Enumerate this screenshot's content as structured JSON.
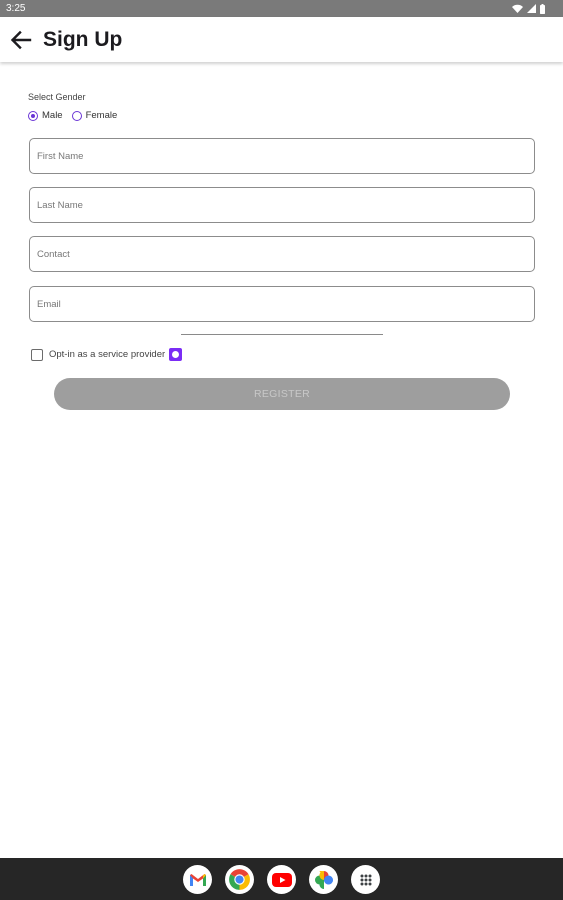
{
  "status_bar": {
    "time": "3:25",
    "icons": [
      "wifi-icon",
      "cellular-signal-icon",
      "battery-icon"
    ]
  },
  "app_bar": {
    "back_icon": "arrow-left-icon",
    "title": "Sign Up"
  },
  "form": {
    "gender_label": "Select Gender",
    "gender_options": [
      {
        "label": "Male",
        "selected": true
      },
      {
        "label": "Female",
        "selected": false
      }
    ],
    "fields": {
      "first_name": {
        "placeholder": "First Name",
        "value": ""
      },
      "last_name": {
        "placeholder": "Last Name",
        "value": ""
      },
      "contact": {
        "placeholder": "Contact",
        "value": ""
      },
      "email": {
        "placeholder": "Email",
        "value": ""
      }
    },
    "optin": {
      "label": "Opt-in as a service provider",
      "checked": false,
      "info_icon": "info-badge-icon"
    },
    "register_label": "REGISTER"
  },
  "taskbar": {
    "apps": [
      "gmail-icon",
      "chrome-icon",
      "youtube-icon",
      "photos-icon",
      "app-drawer-icon"
    ]
  },
  "colors": {
    "accent": "#6a35d6",
    "badge": "#7b2cf5",
    "button_disabled": "#9e9e9e",
    "status_bar": "#7a7a7a",
    "taskbar": "#262626"
  }
}
